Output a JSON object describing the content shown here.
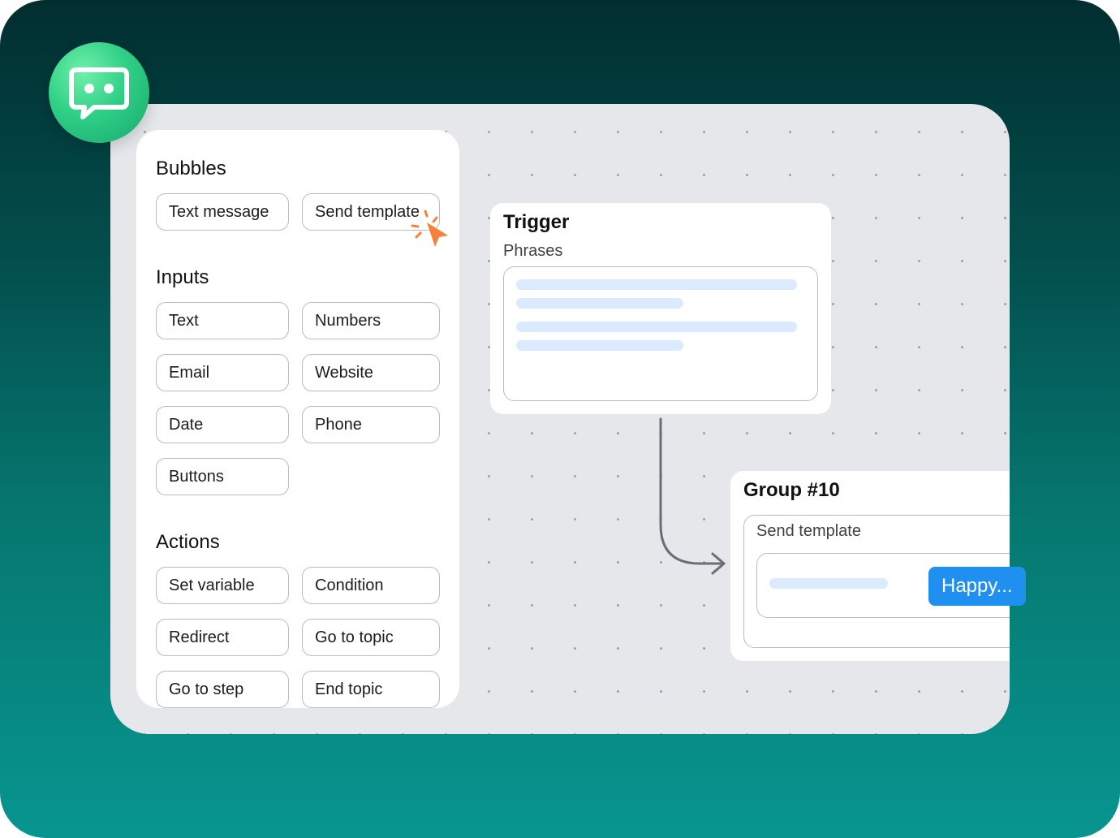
{
  "panel": {
    "sections": [
      {
        "title": "Bubbles",
        "items": [
          "Text message",
          "Send template"
        ]
      },
      {
        "title": "Inputs",
        "items": [
          "Text",
          "Numbers",
          "Email",
          "Website",
          "Date",
          "Phone",
          "Buttons"
        ]
      },
      {
        "title": "Actions",
        "items": [
          "Set variable",
          "Condition",
          "Redirect",
          "Go to topic",
          "Go to step",
          "End topic"
        ]
      }
    ]
  },
  "trigger": {
    "title": "Trigger",
    "subtitle": "Phrases"
  },
  "group": {
    "title": "Group #10",
    "subtitle": "Send template",
    "button_label": "Happy..."
  },
  "colors": {
    "accent": "#1f8ff0",
    "cursor": "#f7813a",
    "logo": "#2fcf86",
    "placeholder_bar": "#dbeafe"
  },
  "icons": {
    "logo": "chat-bubble-icon",
    "cursor": "pointer-cursor-icon"
  }
}
